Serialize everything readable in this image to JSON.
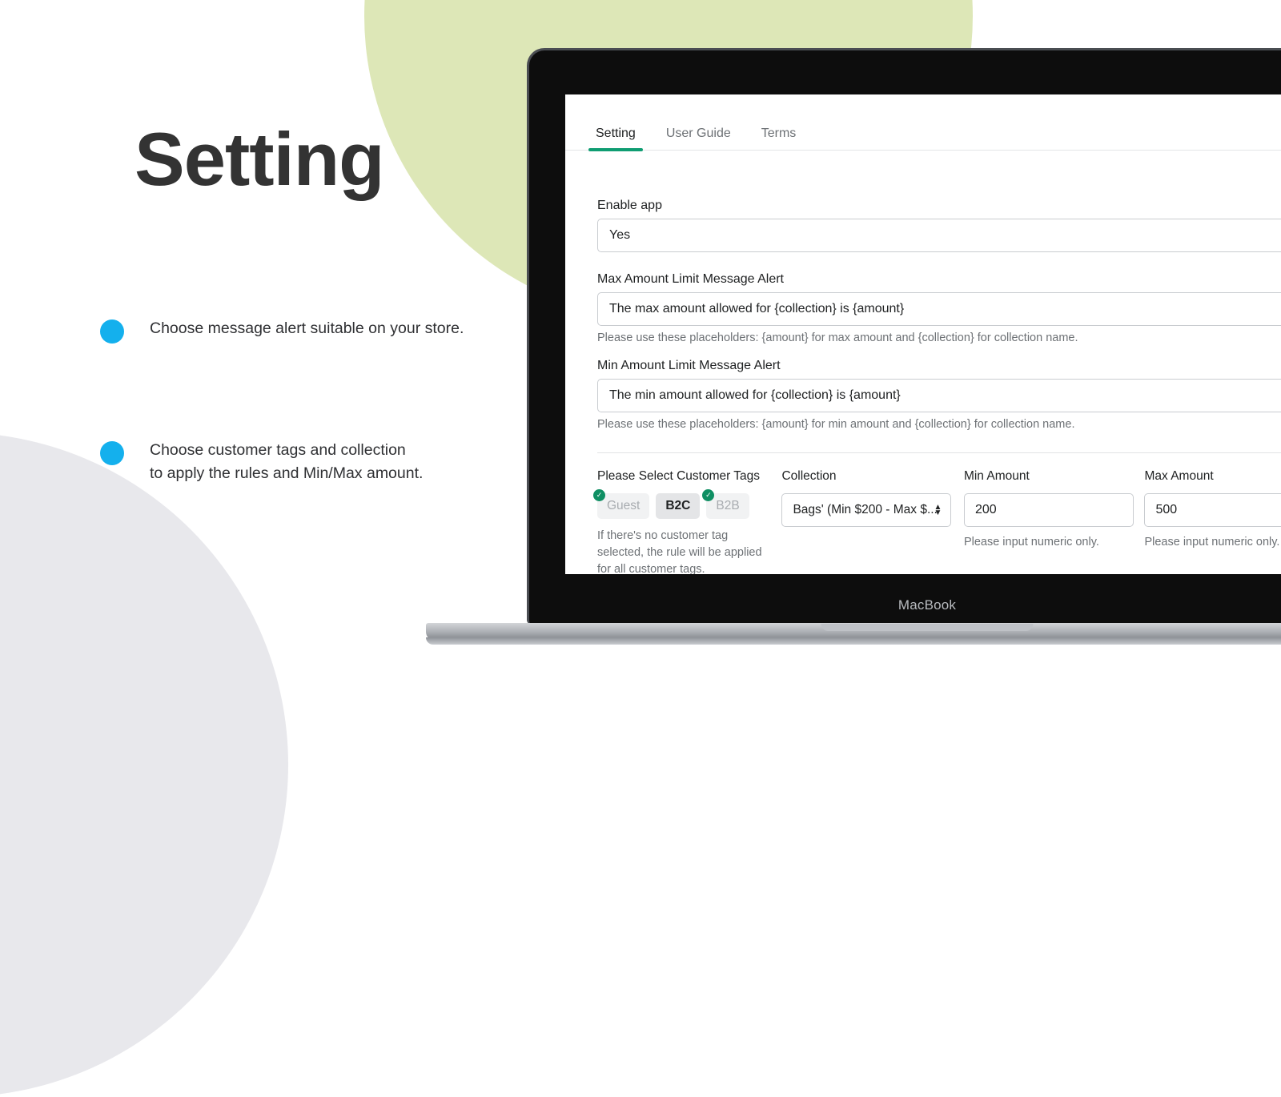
{
  "promo": {
    "title": "Setting",
    "bullets": [
      "Choose message alert suitable on your store.",
      "Choose customer tags and collection\nto apply the rules and Min/Max amount."
    ],
    "accent_bullet_color": "#14b0ed",
    "circle_green_color": "#dde7b7",
    "circle_grey_color": "#e8e8ec"
  },
  "device": {
    "label": "MacBook"
  },
  "app": {
    "accent_color": "#0f9d72",
    "tabs": [
      {
        "label": "Setting",
        "active": true
      },
      {
        "label": "User Guide",
        "active": false
      },
      {
        "label": "Terms",
        "active": false
      }
    ],
    "fields": {
      "enable_app": {
        "label": "Enable app",
        "value": "Yes"
      },
      "max_message": {
        "label": "Max Amount Limit Message Alert",
        "value": "The max amount allowed for {collection} is {amount}",
        "helper": "Please use these placeholders: {amount} for max amount and {collection} for collection name."
      },
      "min_message": {
        "label": "Min Amount Limit Message Alert",
        "value": "The min amount allowed for {collection} is {amount}",
        "helper": "Please use these placeholders: {amount} for min amount and {collection} for collection name."
      }
    },
    "rules": {
      "tags": {
        "label": "Please Select Customer Tags",
        "items": [
          {
            "label": "Guest",
            "checked": true,
            "selected": false
          },
          {
            "label": "B2C",
            "checked": false,
            "selected": true
          },
          {
            "label": "B2B",
            "checked": true,
            "selected": false
          }
        ],
        "helper": "If there's no customer tag\nselected, the rule will be applied\nfor all customer tags."
      },
      "collection": {
        "label": "Collection",
        "value": "Bags' (Min $200 - Max $..."
      },
      "min_amount": {
        "label": "Min Amount",
        "value": "200",
        "helper": "Please input numeric only."
      },
      "max_amount": {
        "label": "Max Amount",
        "value": "500",
        "helper": "Please input numeric only."
      }
    }
  }
}
